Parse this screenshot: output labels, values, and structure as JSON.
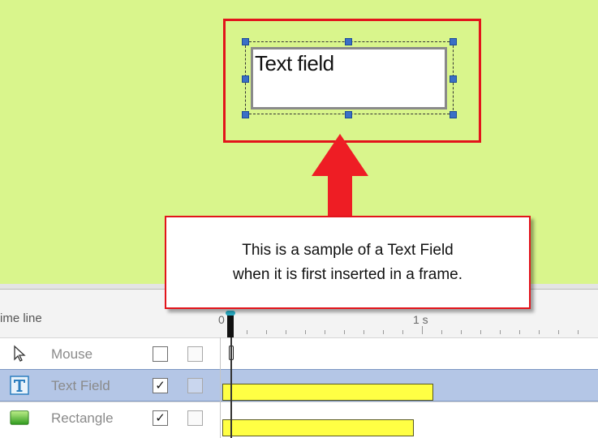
{
  "canvas": {
    "text_field_label": "Text field",
    "background_color": "#d9f58c",
    "highlight_color": "#e2141b"
  },
  "callout": {
    "line1": "This is a sample of a Text Field",
    "line2": "when it is first inserted in a frame."
  },
  "timeline": {
    "title": "ime line",
    "ruler_labels": [
      "0 s",
      "1 s"
    ],
    "rows": [
      {
        "name": "Mouse",
        "icon": "mouse-pointer-icon",
        "checked": false
      },
      {
        "name": "Text Field",
        "icon": "text-field-icon",
        "checked": true
      },
      {
        "name": "Rectangle",
        "icon": "rectangle-icon",
        "checked": true
      }
    ],
    "checkmark": "✓",
    "bar_color": "#ffff44",
    "selected_row_color": "#b4c6e6"
  }
}
